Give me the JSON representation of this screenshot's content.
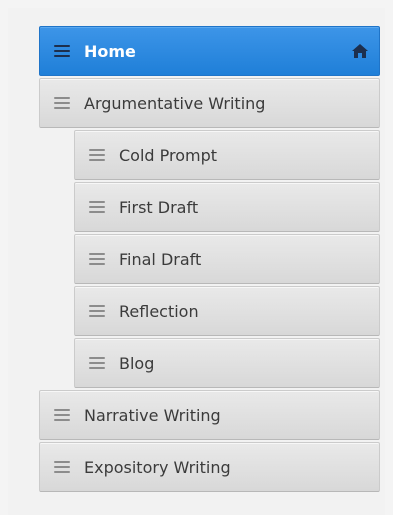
{
  "nav": {
    "items": [
      {
        "label": "Home",
        "active": true,
        "icon": "burger-icon",
        "trailing_icon": "home-icon"
      },
      {
        "label": "Argumentative Writing",
        "active": false,
        "icon": "burger-icon"
      },
      {
        "label": "Cold Prompt",
        "active": false,
        "icon": "burger-icon"
      },
      {
        "label": "First Draft",
        "active": false,
        "icon": "burger-icon"
      },
      {
        "label": "Final Draft",
        "active": false,
        "icon": "burger-icon"
      },
      {
        "label": "Reflection",
        "active": false,
        "icon": "burger-icon"
      },
      {
        "label": "Blog",
        "active": false,
        "icon": "burger-icon"
      },
      {
        "label": "Narrative Writing",
        "active": false,
        "icon": "burger-icon"
      },
      {
        "label": "Expository Writing",
        "active": false,
        "icon": "burger-icon"
      }
    ]
  },
  "colors": {
    "active_bg": "#2b86de",
    "active_text": "#ffffff",
    "item_bg": "#e2e2e2",
    "item_text": "#3b3b3b",
    "icon_active": "#1d2f4d",
    "icon_default": "#8c8c8c"
  }
}
